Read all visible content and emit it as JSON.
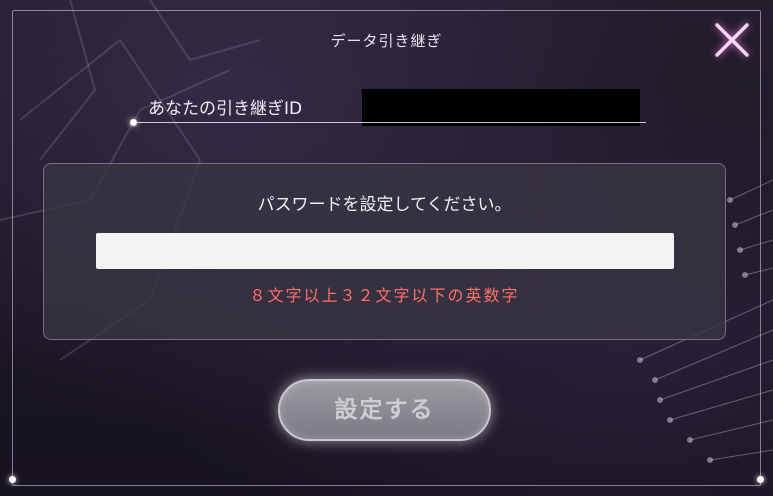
{
  "dialog": {
    "title": "データ引き継ぎ"
  },
  "transfer_id": {
    "label": "あなたの引き継ぎID",
    "value": ""
  },
  "password_panel": {
    "prompt": "パスワードを設定してください。",
    "input_value": "",
    "hint": "８文字以上３２文字以下の英数字"
  },
  "actions": {
    "submit_label": "設定する"
  },
  "icons": {
    "close": "close-icon"
  },
  "colors": {
    "hint": "#ff6f6a",
    "close_icon": "#f0c8ee",
    "button_disabled": "#8a8890"
  }
}
